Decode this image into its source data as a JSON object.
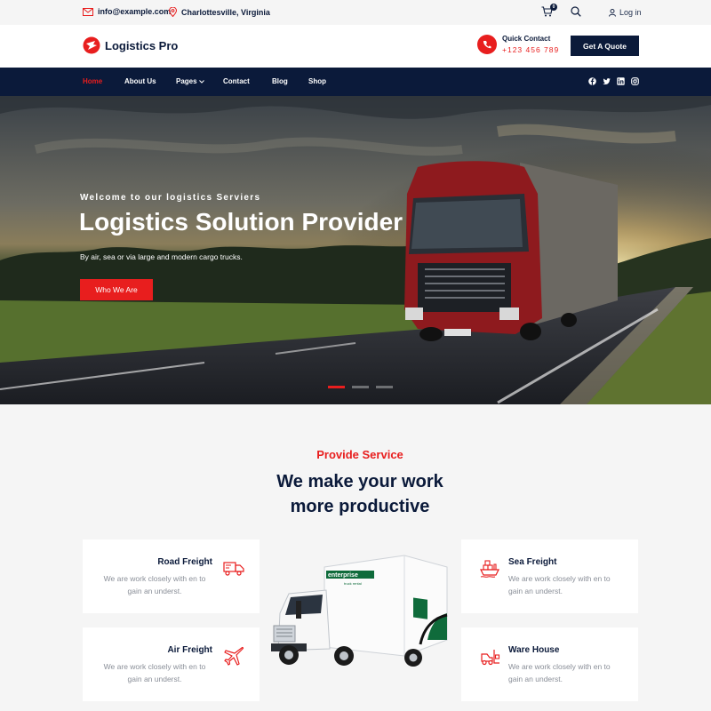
{
  "topbar": {
    "email": "info@example.com",
    "location": "Charlottesville, Virginia",
    "cart_count": "0",
    "login": "Log in"
  },
  "header": {
    "logo_text": "Logistics Pro",
    "quick_contact_label": "Quick Contact",
    "phone": "+123 456 789",
    "quote_button": "Get A Quote"
  },
  "nav": {
    "items": [
      "Home",
      "About Us",
      "Pages",
      "Contact",
      "Blog",
      "Shop"
    ],
    "active": "Home"
  },
  "hero": {
    "subtitle": "Welcome to our logistics Serviers",
    "title": "Logistics Solution Provider",
    "description": "By air, sea or via large and modern cargo trucks.",
    "button": "Who We Are"
  },
  "service": {
    "eyebrow": "Provide Service",
    "title_line1": "We make your work",
    "title_line2": "more productive",
    "cards": [
      {
        "title": "Road Freight",
        "text": "We are work closely with en to gain an underst.",
        "icon": "delivery-truck-icon"
      },
      {
        "title": "Air Freight",
        "text": "We are work closely with en to gain an underst.",
        "icon": "airplane-icon"
      },
      {
        "title": "Sea Freight",
        "text": "We are work closely with en to gain an underst.",
        "icon": "cargo-ship-icon"
      },
      {
        "title": "Ware House",
        "text": "We are work closely with en to gain an underst.",
        "icon": "forklift-icon"
      }
    ],
    "truck_brand": "enterprise",
    "truck_sub": "truck rental"
  },
  "colors": {
    "accent": "#e81e1e",
    "navy": "#0b1a3a",
    "background": "#f5f5f5"
  }
}
